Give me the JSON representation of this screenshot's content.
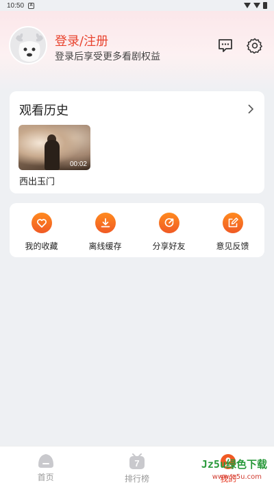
{
  "status": {
    "time": "10:50",
    "notif": "A"
  },
  "header": {
    "login_title": "登录/注册",
    "login_sub": "登录后享受更多看剧权益"
  },
  "history": {
    "title": "观看历史",
    "items": [
      {
        "title": "西出玉门",
        "duration": "00:02"
      }
    ]
  },
  "actions": [
    {
      "label": "我的收藏",
      "icon": "heart-icon"
    },
    {
      "label": "离线缓存",
      "icon": "download-icon"
    },
    {
      "label": "分享好友",
      "icon": "share-icon"
    },
    {
      "label": "意见反馈",
      "icon": "edit-icon"
    }
  ],
  "nav": [
    {
      "label": "首页",
      "icon": "home-icon"
    },
    {
      "label": "排行榜",
      "icon": "ranking-icon",
      "badge": "7"
    },
    {
      "label": "我的",
      "icon": "profile-icon"
    }
  ],
  "watermark": {
    "line1": "Jz5u绿色下载",
    "line2": "www.Jz5u.com"
  },
  "colors": {
    "accent": "#e8432e",
    "action_gradient_top": "#ff8a1f",
    "action_gradient_bottom": "#f05a24"
  }
}
